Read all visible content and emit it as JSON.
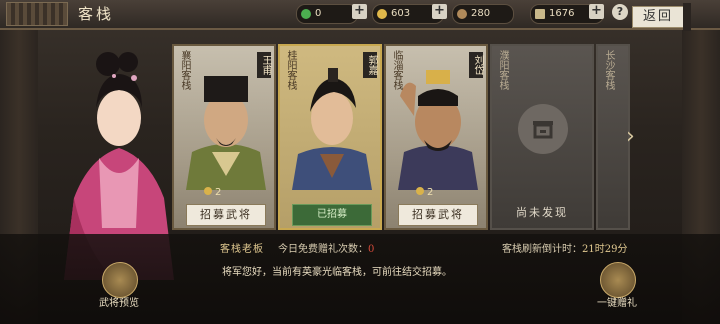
{
  "header": {
    "title": "客栈",
    "back_label": "返回",
    "help_label": "?"
  },
  "resources": [
    {
      "name": "jade",
      "value": "0",
      "color": "#4caf50"
    },
    {
      "name": "gold",
      "value": "603",
      "color": "#e0b84a"
    },
    {
      "name": "copper",
      "value": "280",
      "color": "#b08a5a"
    },
    {
      "name": "tokens",
      "value": "1676",
      "color": "#c8b88a"
    }
  ],
  "cards": [
    {
      "inn": "襄阳客栈",
      "hero": "王甫",
      "cost": "2",
      "button": "招募武将",
      "state": "available"
    },
    {
      "inn": "桂阳客栈",
      "hero": "郭嘉",
      "cost": "",
      "button": "已招募",
      "state": "recruited"
    },
    {
      "inn": "临淄客栈",
      "hero": "刘岱",
      "cost": "2",
      "button": "招募武将",
      "state": "available"
    },
    {
      "inn": "濮阳客栈",
      "hero": "",
      "cost": "",
      "button": "尚未发现",
      "state": "undiscovered"
    },
    {
      "inn": "长沙客栈",
      "hero": "",
      "cost": "",
      "button": "",
      "state": "partial"
    }
  ],
  "footer": {
    "keeper_label": "客栈老板",
    "free_label": "今日免费赠礼次数：",
    "free_count": "0",
    "refresh_label": "客栈刷新倒计时：",
    "refresh_time": "21时29分",
    "message": "将军您好，当前有英豪光临客栈，可前往结交招募。",
    "preview_label": "武将预览",
    "gift_label": "一键赠礼"
  },
  "colors": {
    "accent": "#c8a850",
    "recruited": "#3c6a38",
    "highlight": "#d44a3a"
  }
}
